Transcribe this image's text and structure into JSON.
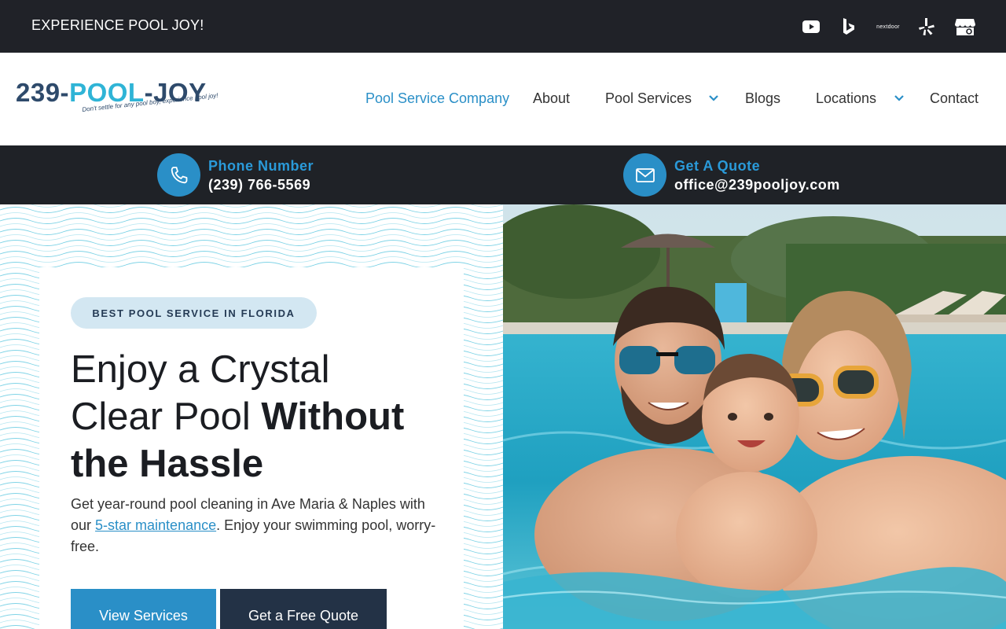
{
  "topbar": {
    "tagline": "EXPERIENCE POOL JOY!",
    "social_icons": [
      "youtube-icon",
      "bing-icon",
      "nextdoor-icon",
      "yelp-icon",
      "google-business-icon"
    ],
    "nextdoor_label": "nextdoor"
  },
  "logo": {
    "prefix": "239-",
    "pool": "POOL",
    "suffix": "-JOY",
    "tagline": "Don't settle for any pool boy, experience pool joy!"
  },
  "nav": {
    "items": [
      {
        "label": "Pool Service Company",
        "active": true
      },
      {
        "label": "About"
      },
      {
        "label": "Pool Services",
        "dropdown": true
      },
      {
        "label": "Blogs"
      },
      {
        "label": "Locations",
        "dropdown": true
      },
      {
        "label": "Contact"
      }
    ]
  },
  "contact": {
    "phone_label": "Phone Number",
    "phone_value": "(239) 766-5569",
    "quote_label": "Get A Quote",
    "quote_value": "office@239pooljoy.com"
  },
  "hero": {
    "badge": "BEST POOL SERVICE IN FLORIDA",
    "headline_1": "Enjoy a Crystal",
    "headline_2": "Clear Pool ",
    "headline_bold_1": "Without",
    "headline_bold_2": "the Hassle",
    "desc_before": "Get year-round pool cleaning in Ave Maria & Naples with our ",
    "desc_link": "5-star maintenance",
    "desc_after": ". Enjoy your swimming pool, worry-free.",
    "btn_services": "View Services",
    "btn_quote": "Get a Free Quote"
  },
  "colors": {
    "accent": "#2a8fc7",
    "dark": "#202228",
    "navy": "#233246",
    "badge_bg": "#d3e7f2"
  }
}
